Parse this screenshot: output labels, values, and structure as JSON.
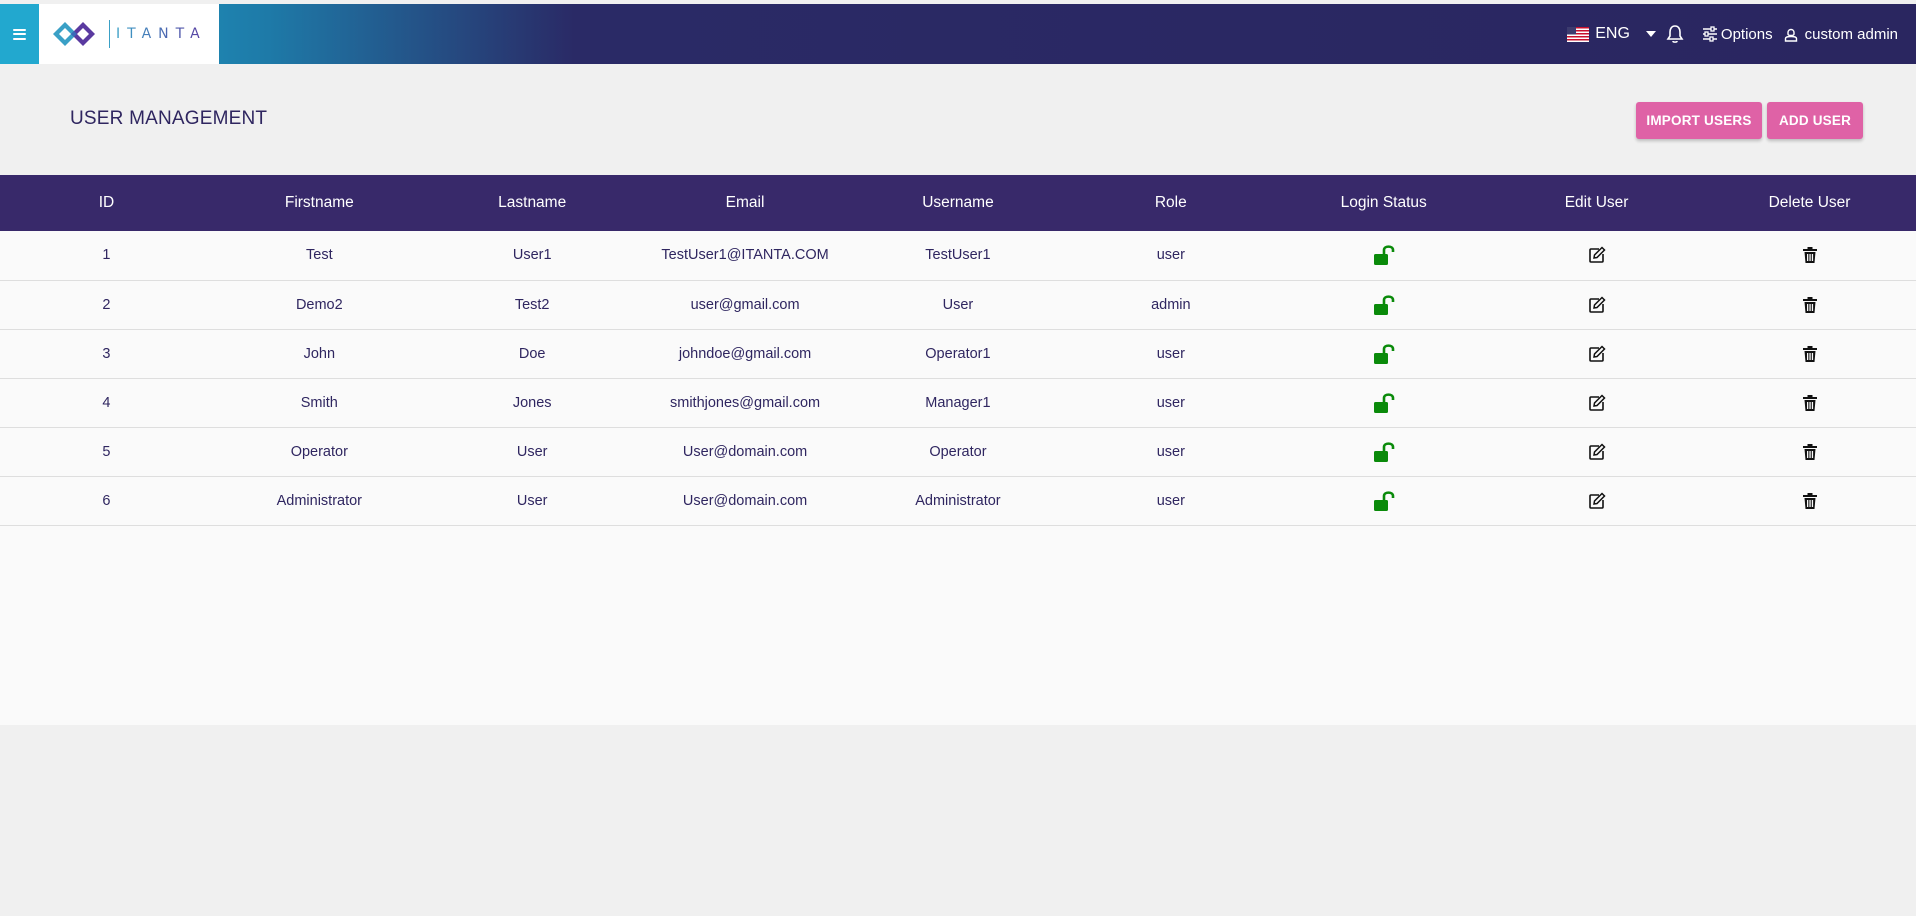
{
  "header": {
    "logo_text": "ITANTA",
    "language": "ENG",
    "options_label": "Options",
    "user_name": "custom admin"
  },
  "page": {
    "title": "USER MANAGEMENT",
    "import_button": "IMPORT USERS",
    "add_button": "ADD USER"
  },
  "table": {
    "columns": [
      "ID",
      "Firstname",
      "Lastname",
      "Email",
      "Username",
      "Role",
      "Login Status",
      "Edit User",
      "Delete User"
    ],
    "rows": [
      {
        "id": "1",
        "firstname": "Test",
        "lastname": "User1",
        "email": "TestUser1@ITANTA.COM",
        "username": "TestUser1",
        "role": "user",
        "login_status_icon": "unlocked-icon"
      },
      {
        "id": "2",
        "firstname": "Demo2",
        "lastname": "Test2",
        "email": "user@gmail.com",
        "username": "User",
        "role": "admin",
        "login_status_icon": "unlocked-icon"
      },
      {
        "id": "3",
        "firstname": "John",
        "lastname": "Doe",
        "email": "johndoe@gmail.com",
        "username": "Operator1",
        "role": "user",
        "login_status_icon": "unlocked-icon"
      },
      {
        "id": "4",
        "firstname": "Smith",
        "lastname": "Jones",
        "email": "smithjones@gmail.com",
        "username": "Manager1",
        "role": "user",
        "login_status_icon": "unlocked-icon"
      },
      {
        "id": "5",
        "firstname": "Operator",
        "lastname": "User",
        "email": "User@domain.com",
        "username": "Operator",
        "role": "user",
        "login_status_icon": "unlocked-icon"
      },
      {
        "id": "6",
        "firstname": "Administrator",
        "lastname": "User",
        "email": "User@domain.com",
        "username": "Administrator",
        "role": "user",
        "login_status_icon": "unlocked-icon"
      }
    ]
  },
  "colors": {
    "header_bg": "#38296a",
    "accent_pink": "#df62a6",
    "unlocked_green": "#0a8a0a",
    "text": "#2f2660"
  }
}
